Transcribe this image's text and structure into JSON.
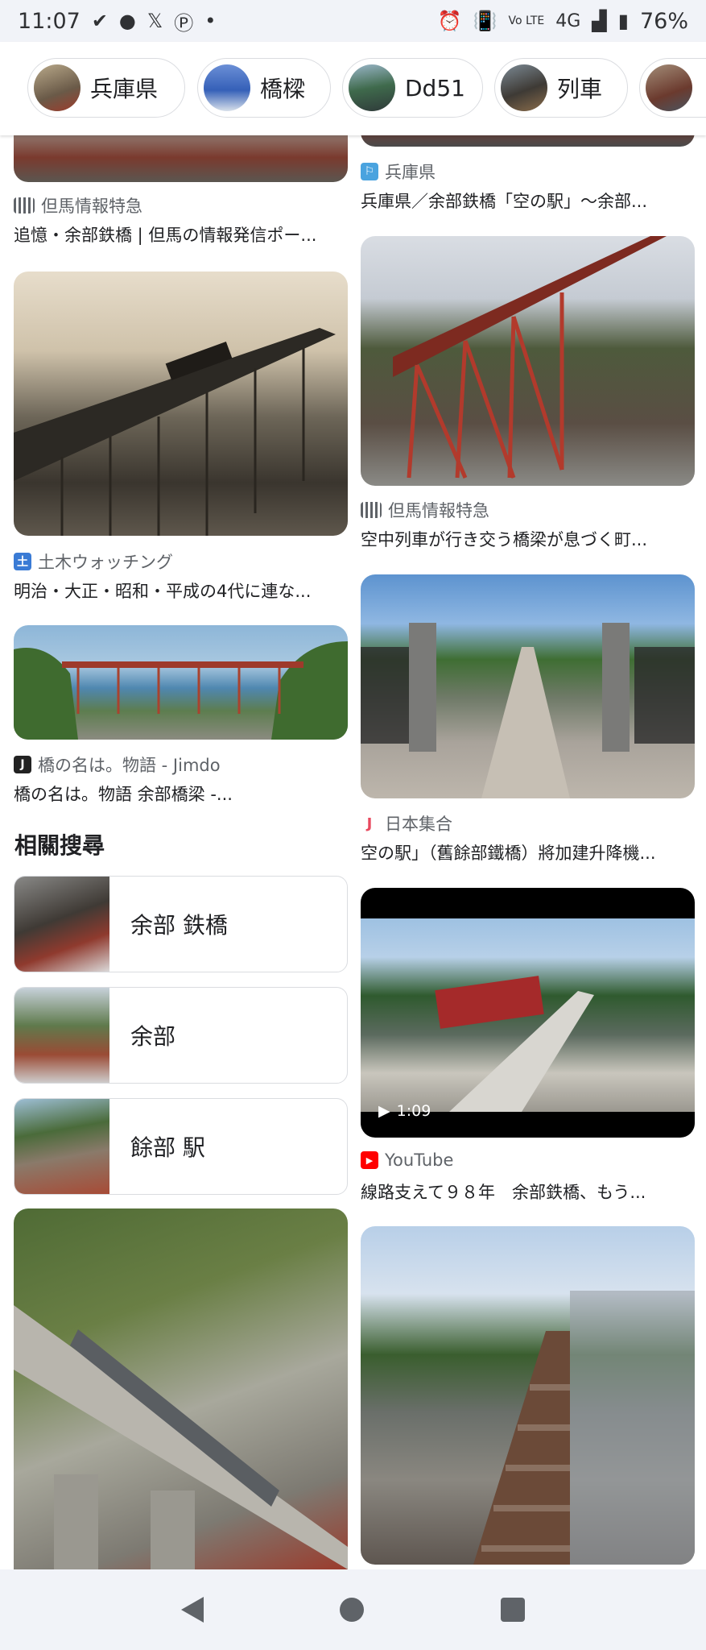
{
  "status": {
    "time": "11:07",
    "network": "4G",
    "battery": "76%",
    "lte": "Vo LTE"
  },
  "chips": [
    {
      "label": "兵庫県"
    },
    {
      "label": "橋樑"
    },
    {
      "label": "Dd51"
    },
    {
      "label": "列車"
    }
  ],
  "results": [
    {
      "source": "但馬情報特急",
      "title": "追憶・余部鉄橋 | 但馬の情報発信ポー..."
    },
    {
      "source": "兵庫県",
      "title": "兵庫県／余部鉄橋「空の駅」～余部..."
    },
    {
      "source": "土木ウォッチング",
      "title": "明治・大正・昭和・平成の4代に連な..."
    },
    {
      "source": "但馬情報特急",
      "title": "空中列車が行き交う橋梁が息づく町..."
    },
    {
      "source": "橋の名は。物語 - Jimdo",
      "title": "橋の名は。物語 余部橋梁 -..."
    },
    {
      "source": "日本集合",
      "title": "空の駅」（舊餘部鐵橋）將加建升降機..."
    },
    {
      "source": "YouTube",
      "title": "線路支えて９８年　余部鉄橋、もう..."
    }
  ],
  "video": {
    "duration": "1:09"
  },
  "related": {
    "heading": "相關搜尋",
    "items": [
      {
        "label": "余部 鉄橋"
      },
      {
        "label": "余部"
      },
      {
        "label": "餘部 駅"
      }
    ]
  }
}
